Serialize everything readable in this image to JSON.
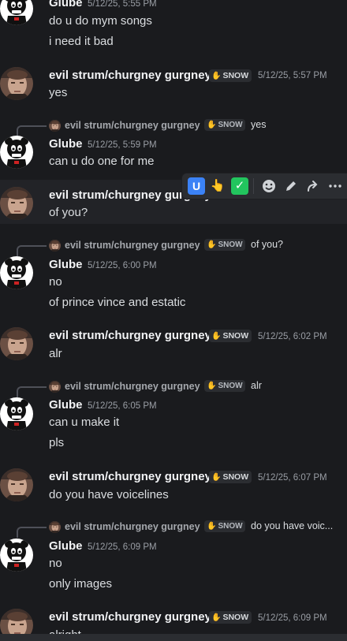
{
  "users": {
    "glube": {
      "name": "Glube"
    },
    "evil": {
      "name": "evil strum/churgney gurgney",
      "tag": "SNOW",
      "tag_icon": "hand-wave-icon"
    }
  },
  "messages": [
    {
      "ts": "5/12/25, 5:55 PM",
      "lines": [
        "do u do mym songs",
        "i need it bad"
      ]
    },
    {
      "ts": "5/12/25, 5:57 PM",
      "lines": [
        "yes"
      ]
    },
    {
      "reply_text": "yes",
      "ts": "5/12/25, 5:59 PM",
      "lines": [
        "can u do one for me"
      ]
    },
    {
      "ts": "",
      "lines": [
        "of you?"
      ]
    },
    {
      "reply_text": "of you?",
      "ts": "5/12/25, 6:00 PM",
      "lines": [
        "no",
        "of prince vince and estatic"
      ]
    },
    {
      "ts": "5/12/25, 6:02 PM",
      "lines": [
        "alr"
      ]
    },
    {
      "reply_text": "alr",
      "ts": "5/12/25, 6:05 PM",
      "lines": [
        "can u make it",
        "pls"
      ]
    },
    {
      "ts": "5/12/25, 6:07 PM",
      "lines": [
        "do you have voicelines"
      ]
    },
    {
      "reply_text": "do you have voic...",
      "ts": "5/12/25, 6:09 PM",
      "lines": [
        "no",
        "only images"
      ]
    },
    {
      "ts": "5/12/25, 6:09 PM",
      "lines": [
        "alright"
      ]
    }
  ],
  "toolbar": {
    "reactions": [
      "U",
      "👆",
      "✅"
    ],
    "actions": [
      "add-reaction-icon",
      "edit-icon",
      "forward-icon",
      "more-icon"
    ]
  },
  "colors": {
    "background": "#1a1b1e",
    "name": "#f2f3f5",
    "timestamp": "#9a9ea5",
    "hover": "#222327"
  }
}
